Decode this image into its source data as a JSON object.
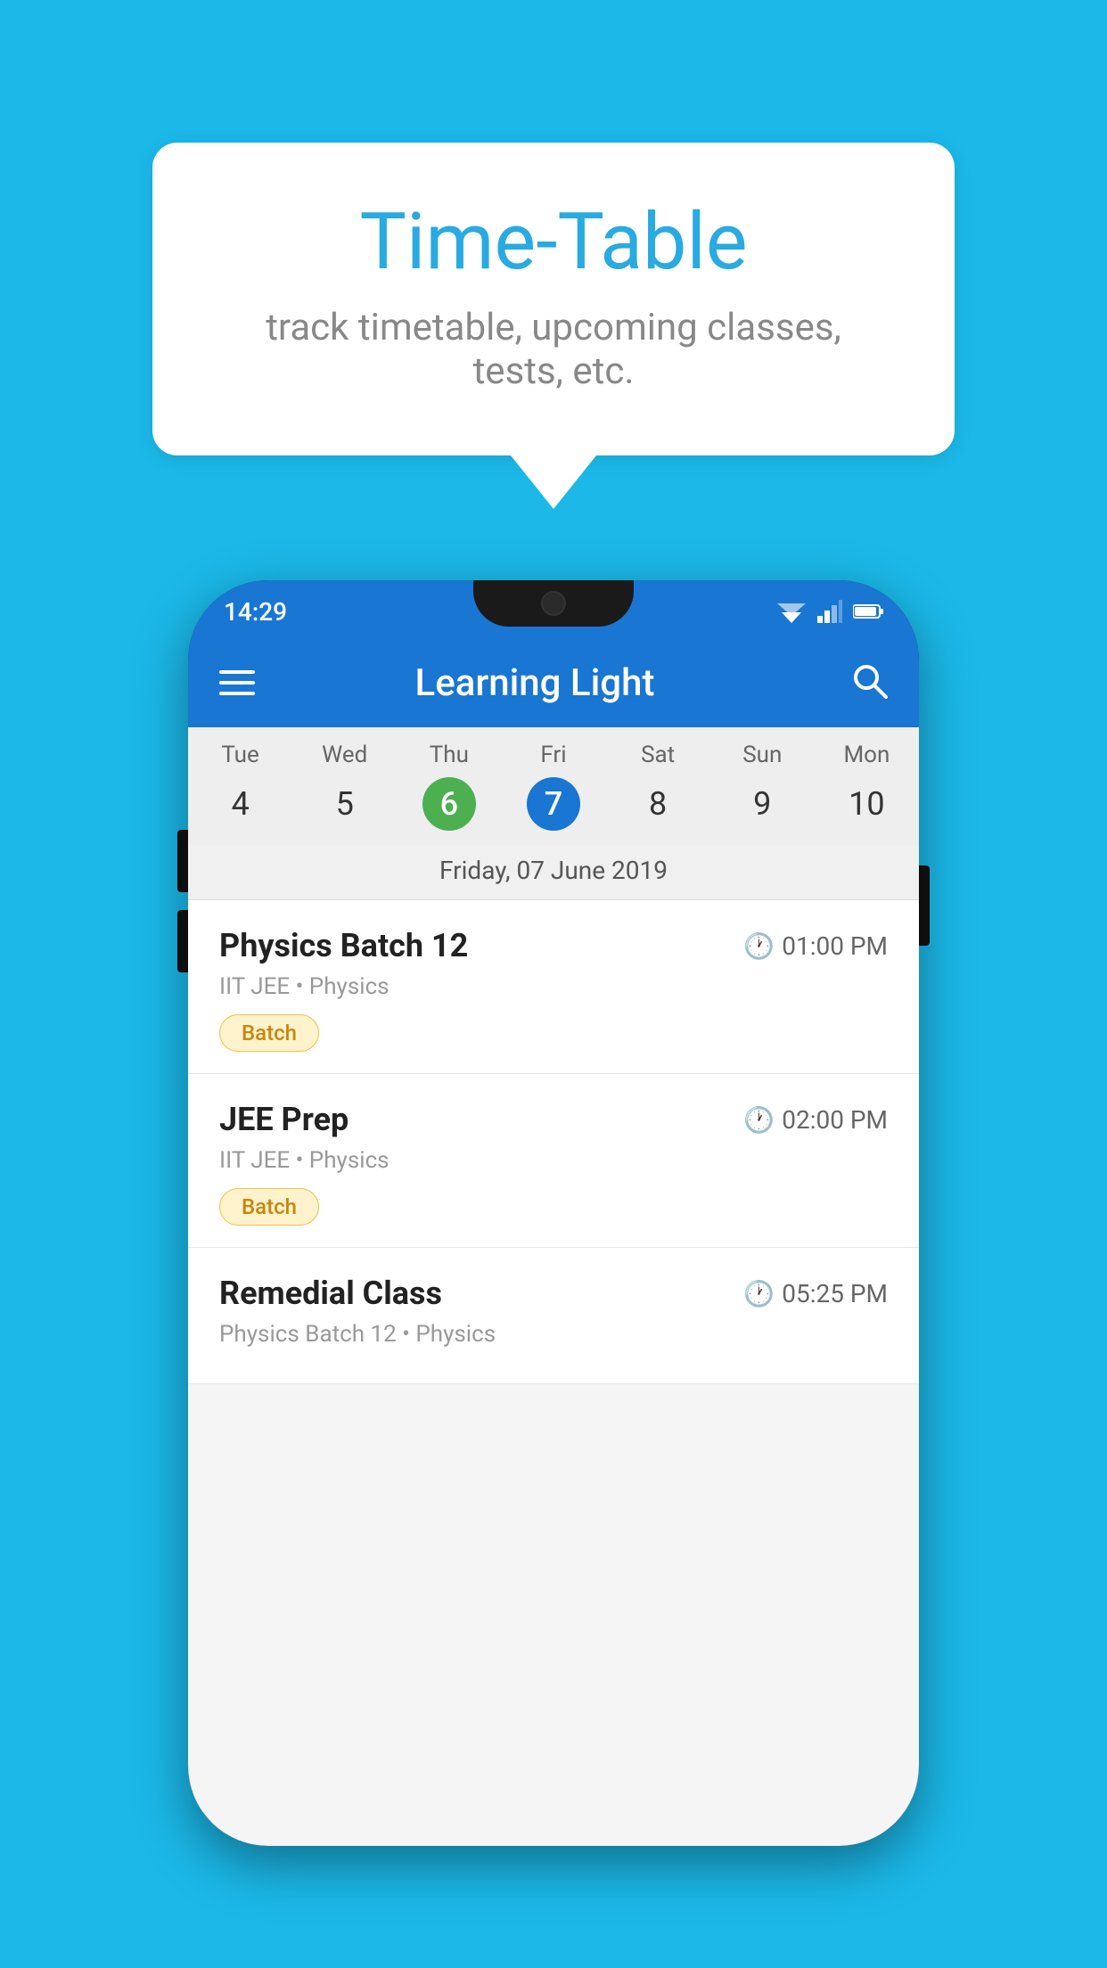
{
  "background_color": "#1BB8E8",
  "speech_bubble": {
    "title": "Time-Table",
    "subtitle": "track timetable, upcoming classes, tests, etc."
  },
  "app": {
    "status_time": "14:29",
    "app_name": "Learning Light"
  },
  "calendar": {
    "days": [
      {
        "name": "Tue",
        "number": "4",
        "state": "normal"
      },
      {
        "name": "Wed",
        "number": "5",
        "state": "normal"
      },
      {
        "name": "Thu",
        "number": "6",
        "state": "today"
      },
      {
        "name": "Fri",
        "number": "7",
        "state": "selected"
      },
      {
        "name": "Sat",
        "number": "8",
        "state": "normal"
      },
      {
        "name": "Sun",
        "number": "9",
        "state": "normal"
      },
      {
        "name": "Mon",
        "number": "10",
        "state": "normal"
      }
    ],
    "selected_date_label": "Friday, 07 June 2019"
  },
  "schedule": [
    {
      "title": "Physics Batch 12",
      "time": "01:00 PM",
      "sub": "IIT JEE • Physics",
      "tag": "Batch"
    },
    {
      "title": "JEE Prep",
      "time": "02:00 PM",
      "sub": "IIT JEE • Physics",
      "tag": "Batch"
    },
    {
      "title": "Remedial Class",
      "time": "05:25 PM",
      "sub": "Physics Batch 12 • Physics",
      "tag": ""
    }
  ]
}
